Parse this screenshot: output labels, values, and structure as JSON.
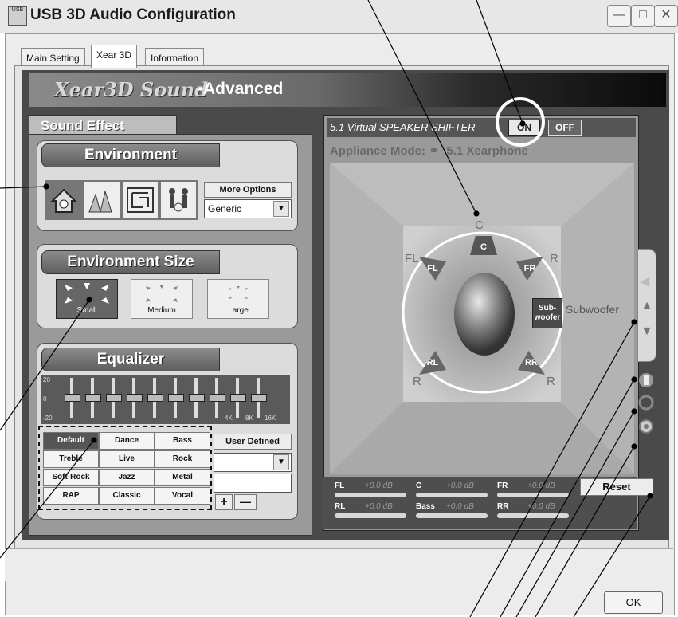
{
  "window": {
    "title": "USB 3D Audio Configuration",
    "app_icon_text": "USB"
  },
  "tabs": [
    "Main Setting",
    "Xear 3D",
    "Information"
  ],
  "banner": {
    "brand": "Xear3D Sound",
    "mode": "-Advanced"
  },
  "sound_effect": {
    "tab_label": "Sound Effect",
    "environment": {
      "header": "Environment",
      "more_options_label": "More Options",
      "selected_option": "Generic",
      "icons": [
        "house-icon",
        "opera-house-icon",
        "maze-icon",
        "stage-icon"
      ]
    },
    "environment_size": {
      "header": "Environment Size",
      "options": [
        "Small",
        "Medium",
        "Large"
      ],
      "selected": "Small"
    },
    "equalizer": {
      "header": "Equalizer",
      "y_labels": [
        "20",
        "0",
        "-20"
      ],
      "freq_labels": [
        "4K",
        "8K",
        "16K"
      ],
      "presets": [
        "Default",
        "Dance",
        "Bass",
        "Treble",
        "Live",
        "Rock",
        "Soft-Rock",
        "Jazz",
        "Metal",
        "RAP",
        "Classic",
        "Vocal"
      ],
      "selected_preset": "Default",
      "user_defined_label": "User Defined",
      "add_label": "+",
      "remove_label": "—"
    }
  },
  "speaker_shifter": {
    "label_prefix": "5.1 Virtual",
    "label_main": "SPEAKER SHIFTER",
    "on_label": "ON",
    "off_label": "OFF",
    "state": "ON",
    "appliance_label": "Appliance Mode:",
    "appliance_value": "5.1 Xearphone",
    "speakers": {
      "C": "C",
      "FL": "FL",
      "FR": "FR",
      "RL": "RL",
      "RR": "RR",
      "sub_box": "Sub-woofer",
      "sub_label": "Subwoofer"
    },
    "outer_labels": {
      "C": "C",
      "FL": "FL",
      "FR": "R",
      "RL": "R",
      "RR": "R"
    }
  },
  "levels": [
    {
      "ch": "FL",
      "val": "+0.0 dB"
    },
    {
      "ch": "C",
      "val": "+0.0 dB"
    },
    {
      "ch": "FR",
      "val": "+0.0 dB"
    },
    {
      "ch": "RL",
      "val": "+0.0 dB"
    },
    {
      "ch": "Bass",
      "val": "+0.0 dB"
    },
    {
      "ch": "RR",
      "val": "+0.0 dB"
    }
  ],
  "reset_label": "Reset",
  "ok_label": "OK"
}
